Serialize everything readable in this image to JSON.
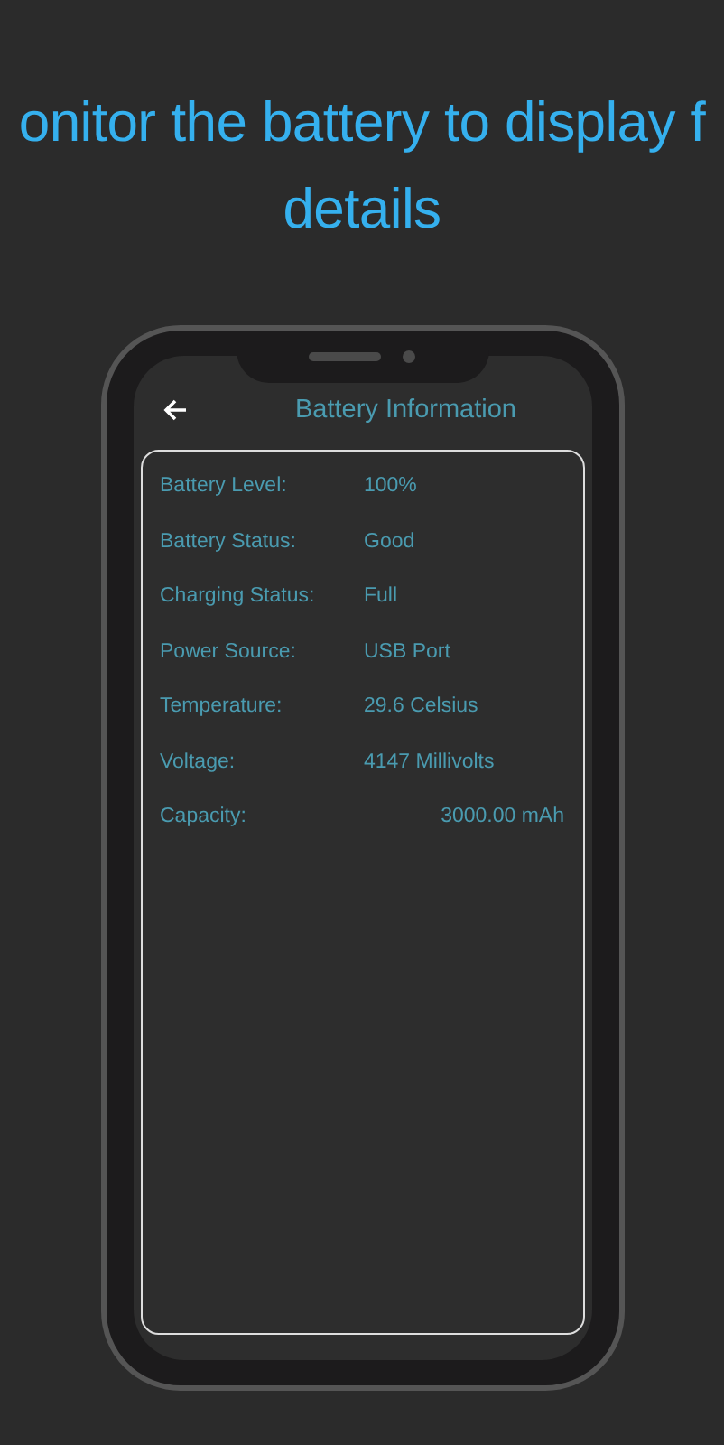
{
  "headline": {
    "lines": [
      "onitor the battery to display f",
      "details"
    ]
  },
  "app_bar": {
    "title": "Battery Information"
  },
  "rows": [
    {
      "label": "Battery Level:",
      "value": "100%",
      "kind": "column"
    },
    {
      "label": "Battery Status:",
      "value": "Good",
      "kind": "column"
    },
    {
      "label": "Charging Status:",
      "value": "Full",
      "kind": "column"
    },
    {
      "label": "Power Source:",
      "value": "USB Port",
      "kind": "column"
    },
    {
      "label": "Temperature:",
      "value": "29.6 Celsius",
      "kind": "column"
    },
    {
      "label": "Voltage:",
      "value": "4147 Millivolts",
      "kind": "column"
    },
    {
      "label": "Capacity:",
      "value": "3000.00 mAh",
      "kind": "right"
    }
  ]
}
